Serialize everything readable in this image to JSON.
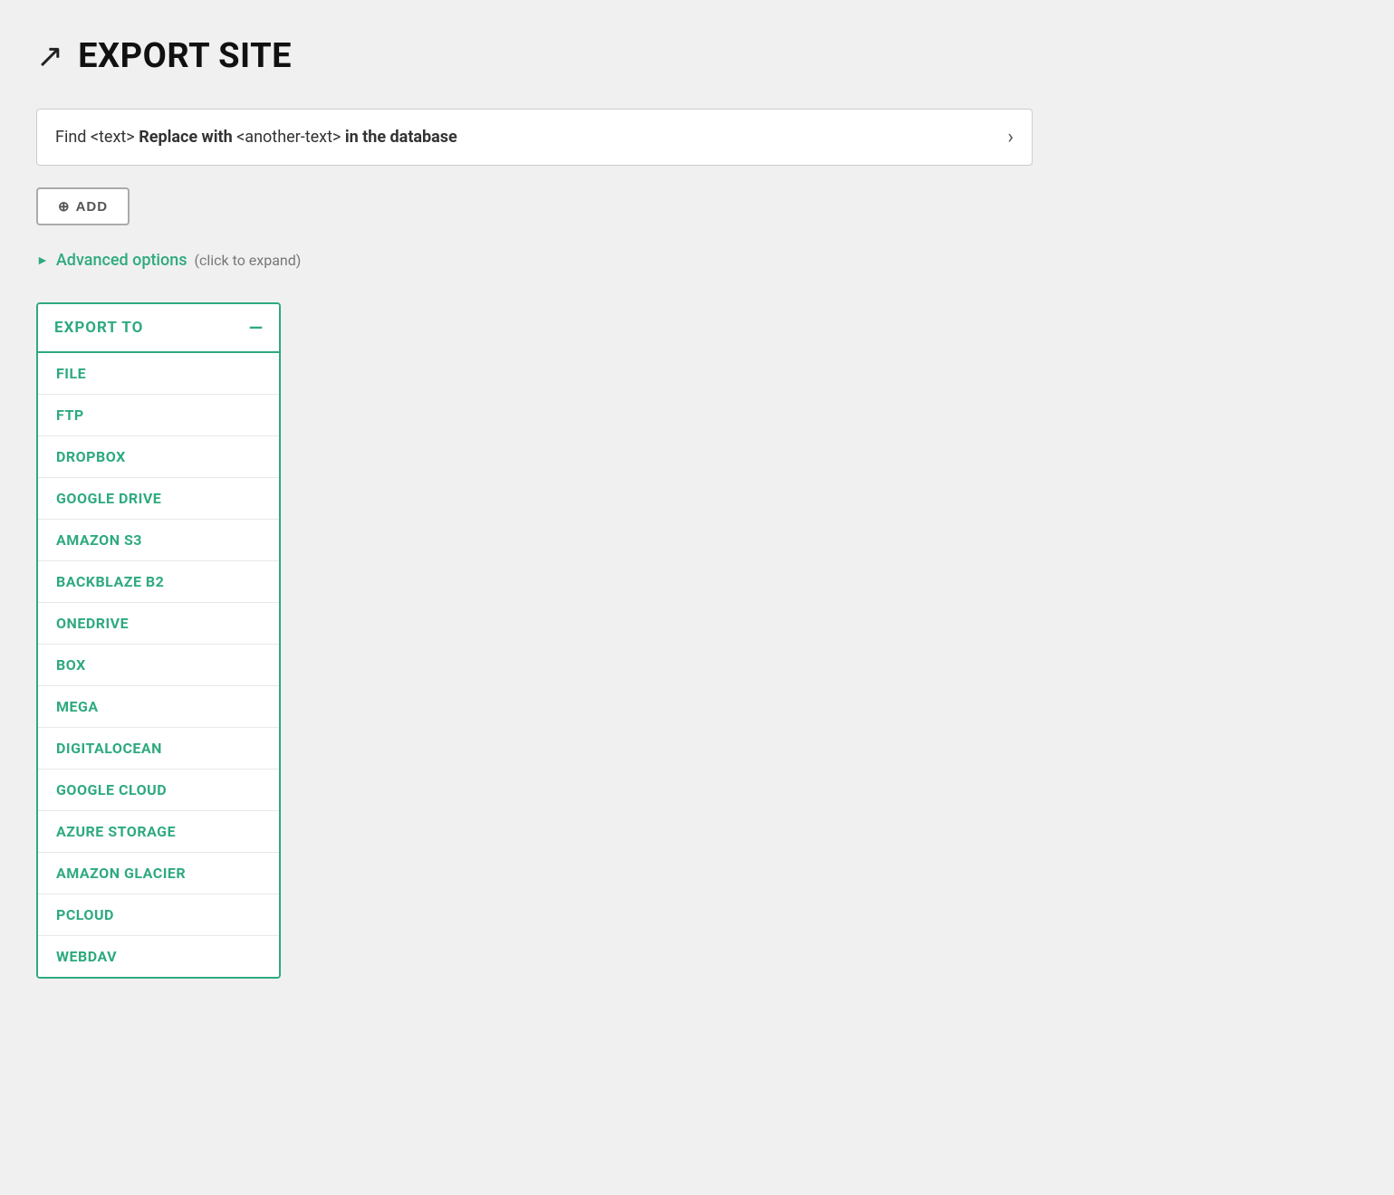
{
  "header": {
    "icon": "↗",
    "title": "EXPORT SITE"
  },
  "find_replace": {
    "prefix": "Find",
    "find_placeholder": "<text>",
    "middle": "Replace with",
    "replace_placeholder": "<another-text>",
    "suffix": "in the database"
  },
  "add_button": {
    "icon": "⊕",
    "label": "ADD"
  },
  "advanced_options": {
    "label": "Advanced options",
    "hint": "(click to expand)"
  },
  "export_to_panel": {
    "header_label": "EXPORT TO",
    "collapse_icon": "—",
    "items": [
      {
        "label": "FILE"
      },
      {
        "label": "FTP"
      },
      {
        "label": "DROPBOX"
      },
      {
        "label": "GOOGLE DRIVE"
      },
      {
        "label": "AMAZON S3"
      },
      {
        "label": "BACKBLAZE B2"
      },
      {
        "label": "ONEDRIVE"
      },
      {
        "label": "BOX"
      },
      {
        "label": "MEGA"
      },
      {
        "label": "DIGITALOCEAN"
      },
      {
        "label": "GOOGLE CLOUD"
      },
      {
        "label": "AZURE STORAGE"
      },
      {
        "label": "AMAZON GLACIER"
      },
      {
        "label": "PCLOUD"
      },
      {
        "label": "WEBDAV"
      }
    ]
  }
}
